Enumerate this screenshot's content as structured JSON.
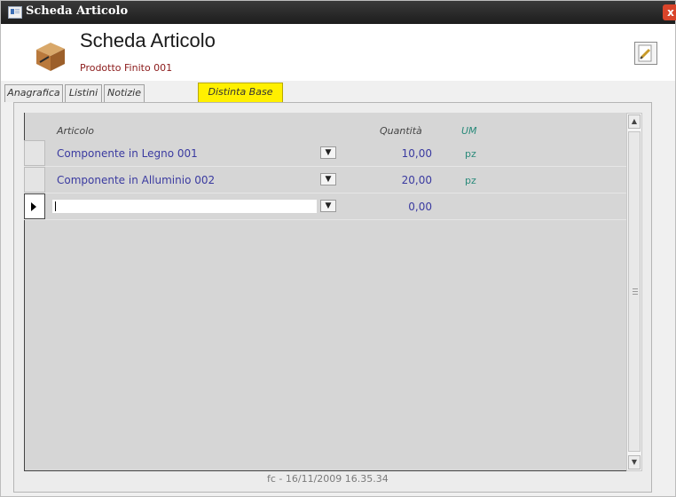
{
  "window": {
    "title": "Scheda Articolo",
    "close_label": "x"
  },
  "header": {
    "title": "Scheda Articolo",
    "subtitle": "Prodotto Finito 001"
  },
  "tabs": [
    {
      "label": "Anagrafica"
    },
    {
      "label": "Listini"
    },
    {
      "label": "Notizie"
    },
    {
      "label": "Distinta Base",
      "active": true
    }
  ],
  "grid": {
    "columns": {
      "articolo": "Articolo",
      "quantita": "Quantità",
      "um": "UM"
    },
    "rows": [
      {
        "articolo": "Componente in Legno 001",
        "quantita": "10,00",
        "um": "pz"
      },
      {
        "articolo": "Componente in Alluminio 002",
        "quantita": "20,00",
        "um": "pz"
      },
      {
        "articolo": "",
        "quantita": "0,00",
        "um": ""
      }
    ]
  },
  "footer": {
    "text": "fc - 16/11/2009 16.35.34"
  },
  "colors": {
    "active_tab": "#fff000",
    "link_text": "#3a3aa0",
    "um_text": "#2a8a7a",
    "subtitle": "#8b1a1a"
  }
}
